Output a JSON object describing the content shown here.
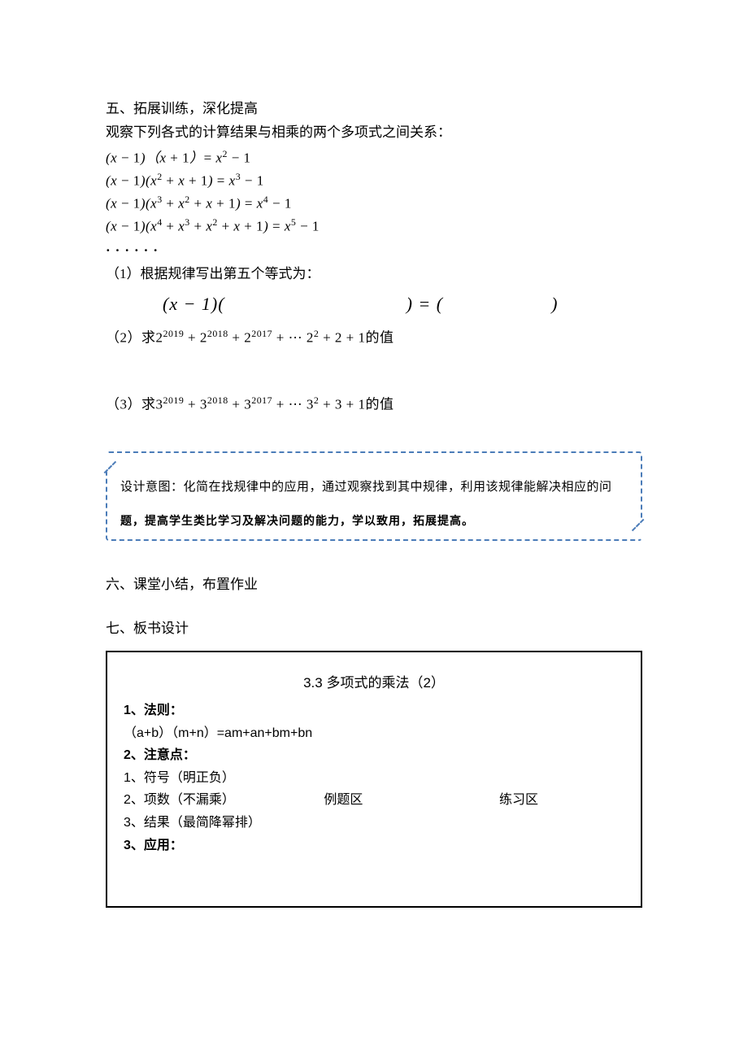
{
  "section5": {
    "title": "五、拓展训练，深化提高",
    "intro": "观察下列各式的计算结果与相乘的两个多项式之间关系：",
    "eq1": "( − 1)（ + 1）= ² − 1",
    "dots": "······",
    "p1_label": "（1）根据规律写出第五个等式为：",
    "p1_formula_left": "(x − 1)(",
    "p1_formula_mid": ") = (",
    "p1_formula_right": ")",
    "p2_prefix": "（2）求",
    "p2_suffix": "的值",
    "p3_prefix": "（3）求",
    "p3_suffix": "的值"
  },
  "design": {
    "line1": "设计意图：化简在找规律中的应用，通过观察找到其中规律，利用该规律能解决相应的问",
    "line2": "题，提高学生类比学习及解决问题的能力，学以致用，拓展提高。"
  },
  "section6": {
    "title": "六、课堂小结，布置作业"
  },
  "section7": {
    "title": "七、板书设计"
  },
  "board": {
    "title": "3.3 多项式的乘法（2）",
    "h1": "1、法则：",
    "formula": "（a+b）（m+n）=am+an+bm+bn",
    "h2": "2、注意点：",
    "n1": "1、符号（明正负）",
    "n2": "2、项数（不漏乘）",
    "n3": "3、结果（最简降幂排）",
    "h3": "3、应用：",
    "col_mid": "例题区",
    "col_right": "练习区"
  }
}
